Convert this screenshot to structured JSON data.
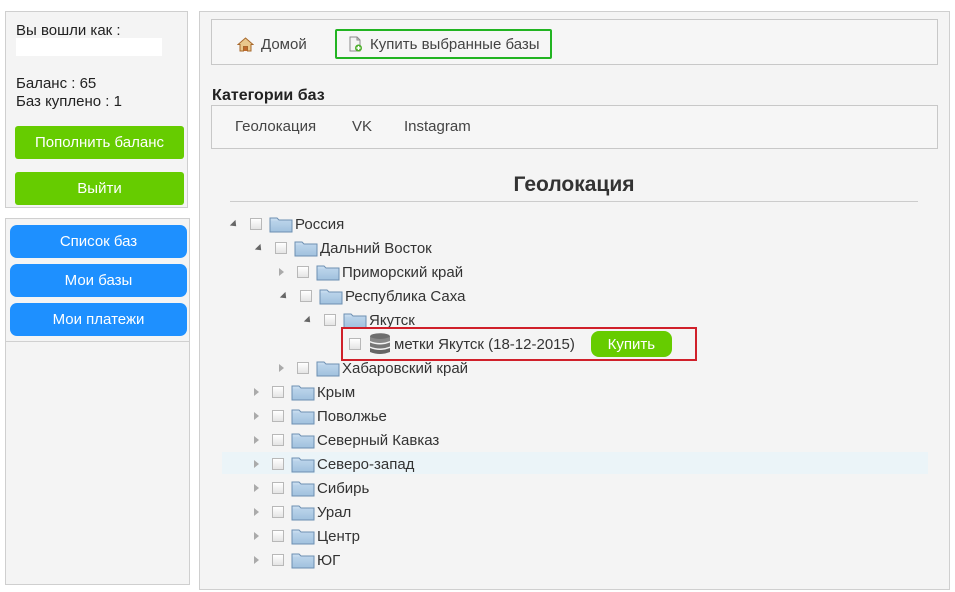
{
  "user": {
    "logged_in_label": "Вы вошли как :",
    "balance_label": "Баланс : 65",
    "bought_label": "Баз куплено : 1",
    "topup_button": "Пополнить баланс",
    "logout_button": "Выйти"
  },
  "nav": {
    "items": [
      {
        "label": "Список баз"
      },
      {
        "label": "Мои базы"
      },
      {
        "label": "Мои платежи"
      }
    ]
  },
  "toolbar": {
    "home_label": "Домой",
    "buy_selected_label": "Купить выбранные базы"
  },
  "categories": {
    "title": "Категории баз",
    "tabs": [
      {
        "label": "Геолокация"
      },
      {
        "label": "VK"
      },
      {
        "label": "Instagram"
      }
    ]
  },
  "geo": {
    "title": "Геолокация",
    "tree": {
      "root": "Россия",
      "far_east": "Дальний Восток",
      "primorsky": "Приморский край",
      "sakha": "Республика Саха",
      "yakutsk": "Якутск",
      "leaf_label": "метки Якутск (18-12-2015)",
      "buy_button": "Купить",
      "khabarovsk": "Хабаровский край",
      "regions": [
        "Крым",
        "Поволжье",
        "Северный Кавказ",
        "Северо-запад",
        "Сибирь",
        "Урал",
        "Центр",
        "ЮГ"
      ]
    }
  },
  "colors": {
    "green": "#66cc00",
    "blue": "#1e90ff",
    "highlight_border": "#d0202a",
    "toolbar_border": "#22b422"
  }
}
